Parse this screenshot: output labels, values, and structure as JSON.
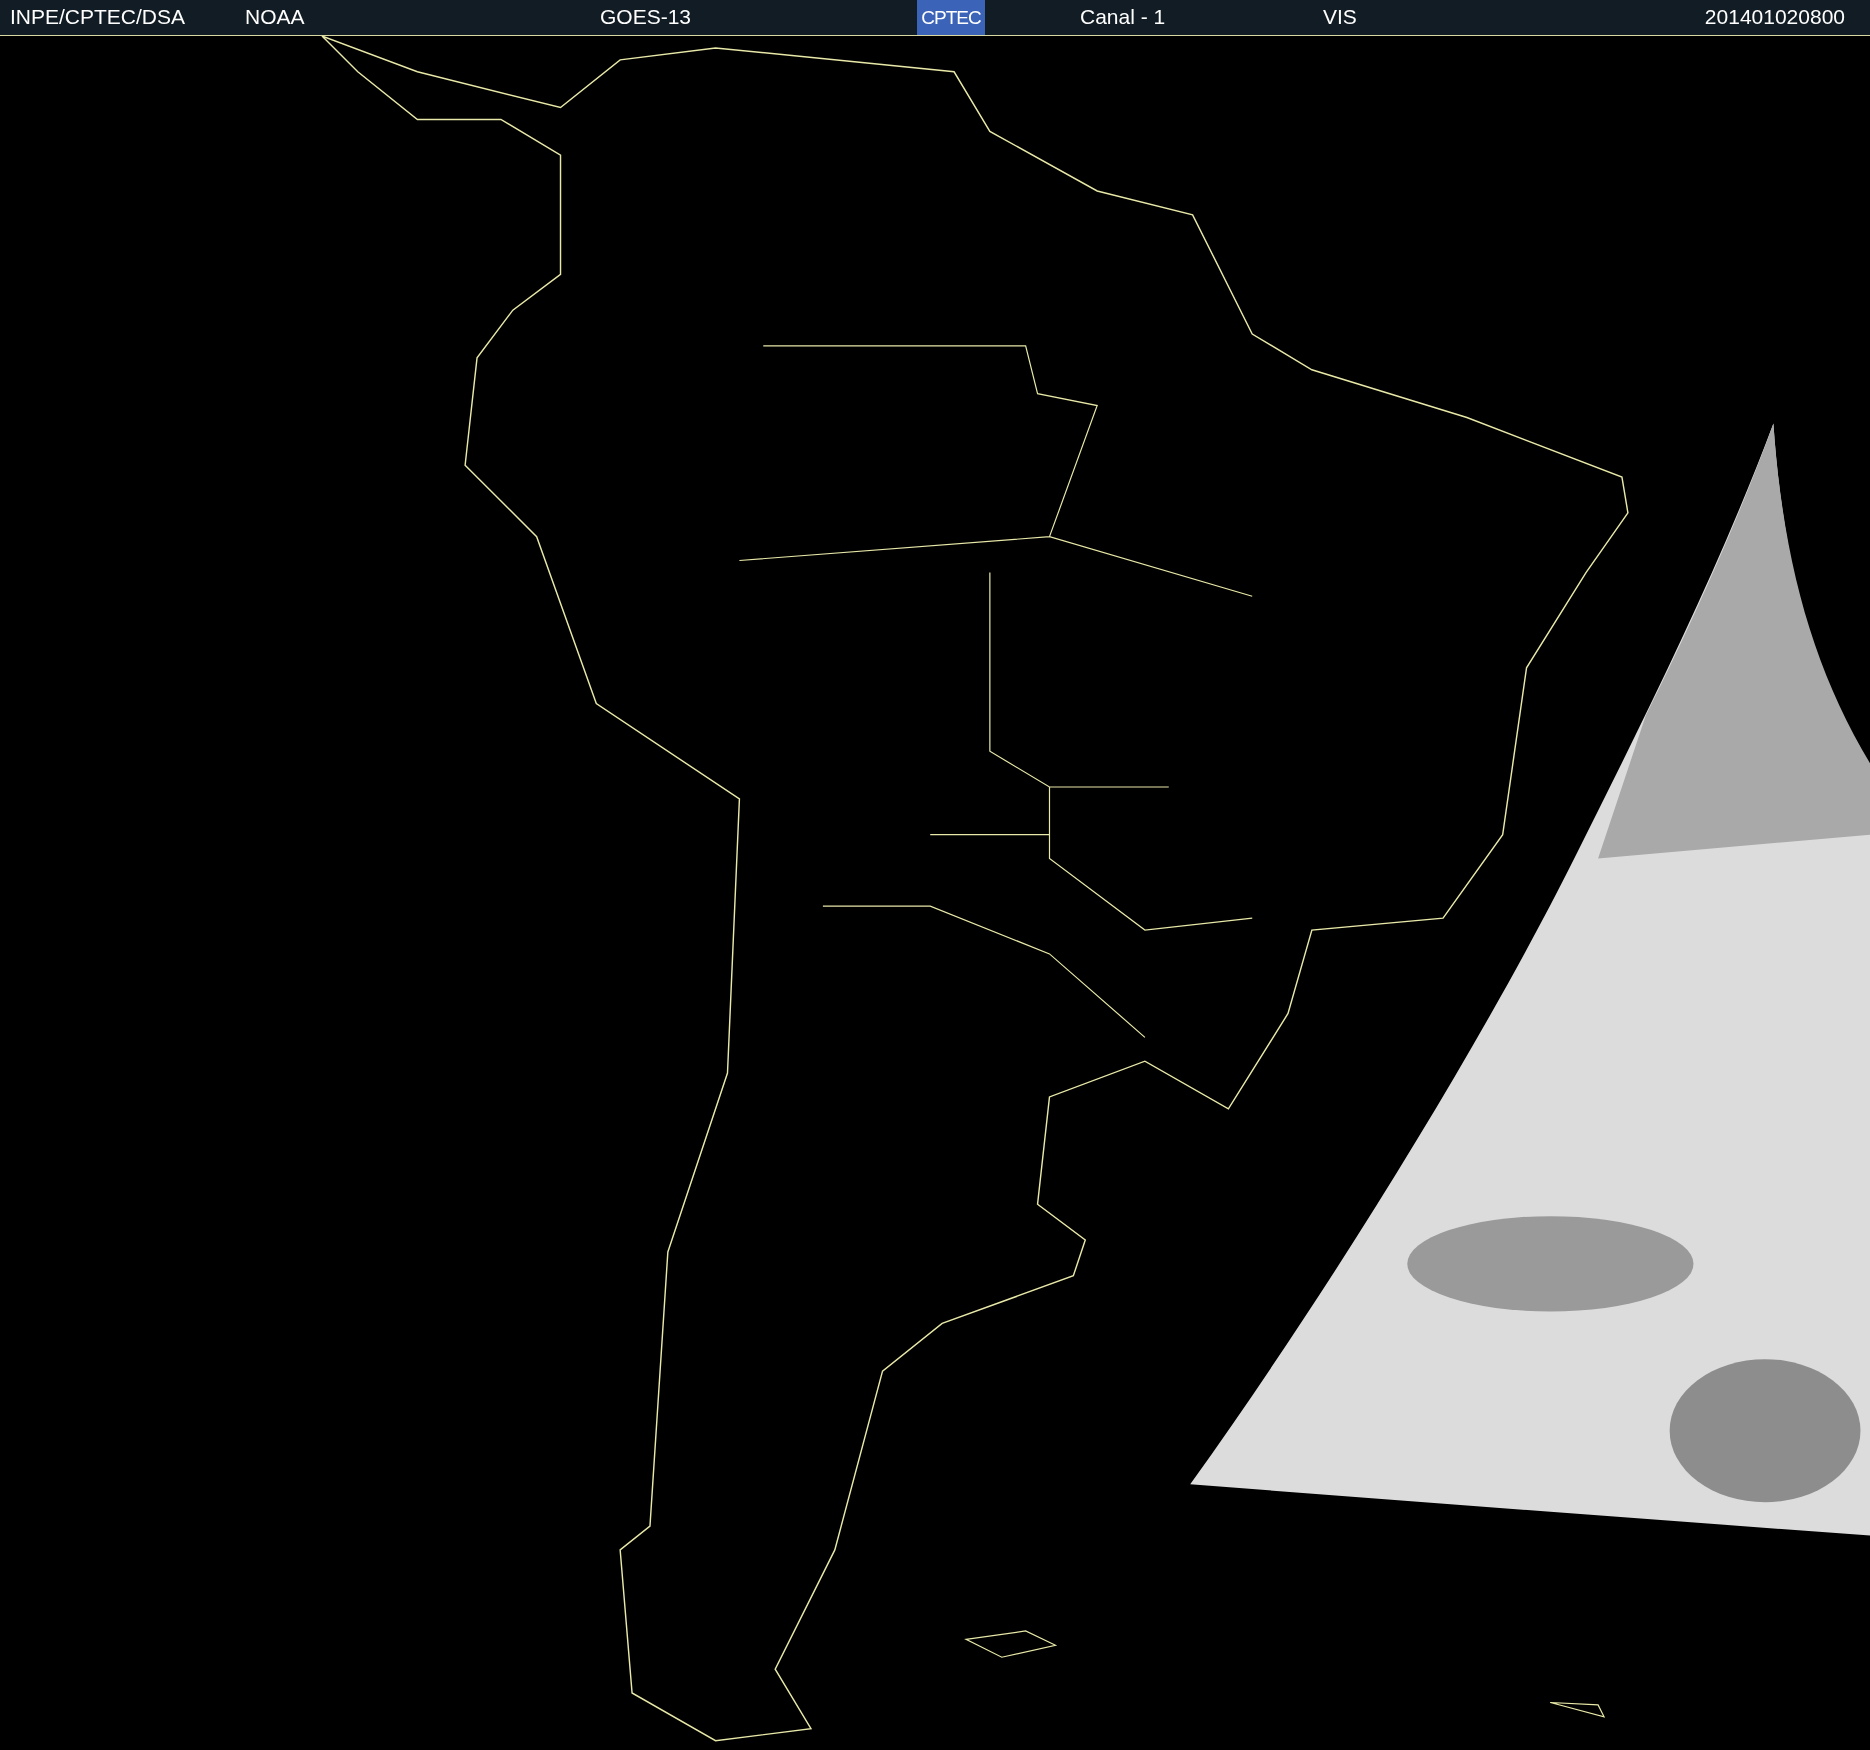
{
  "header": {
    "source": "INPE/CPTEC/DSA",
    "agency": "NOAA",
    "satellite": "GOES-13",
    "logo_text": "CPTEC",
    "channel": "Canal - 1",
    "band": "VIS",
    "timestamp": "201401020800"
  }
}
